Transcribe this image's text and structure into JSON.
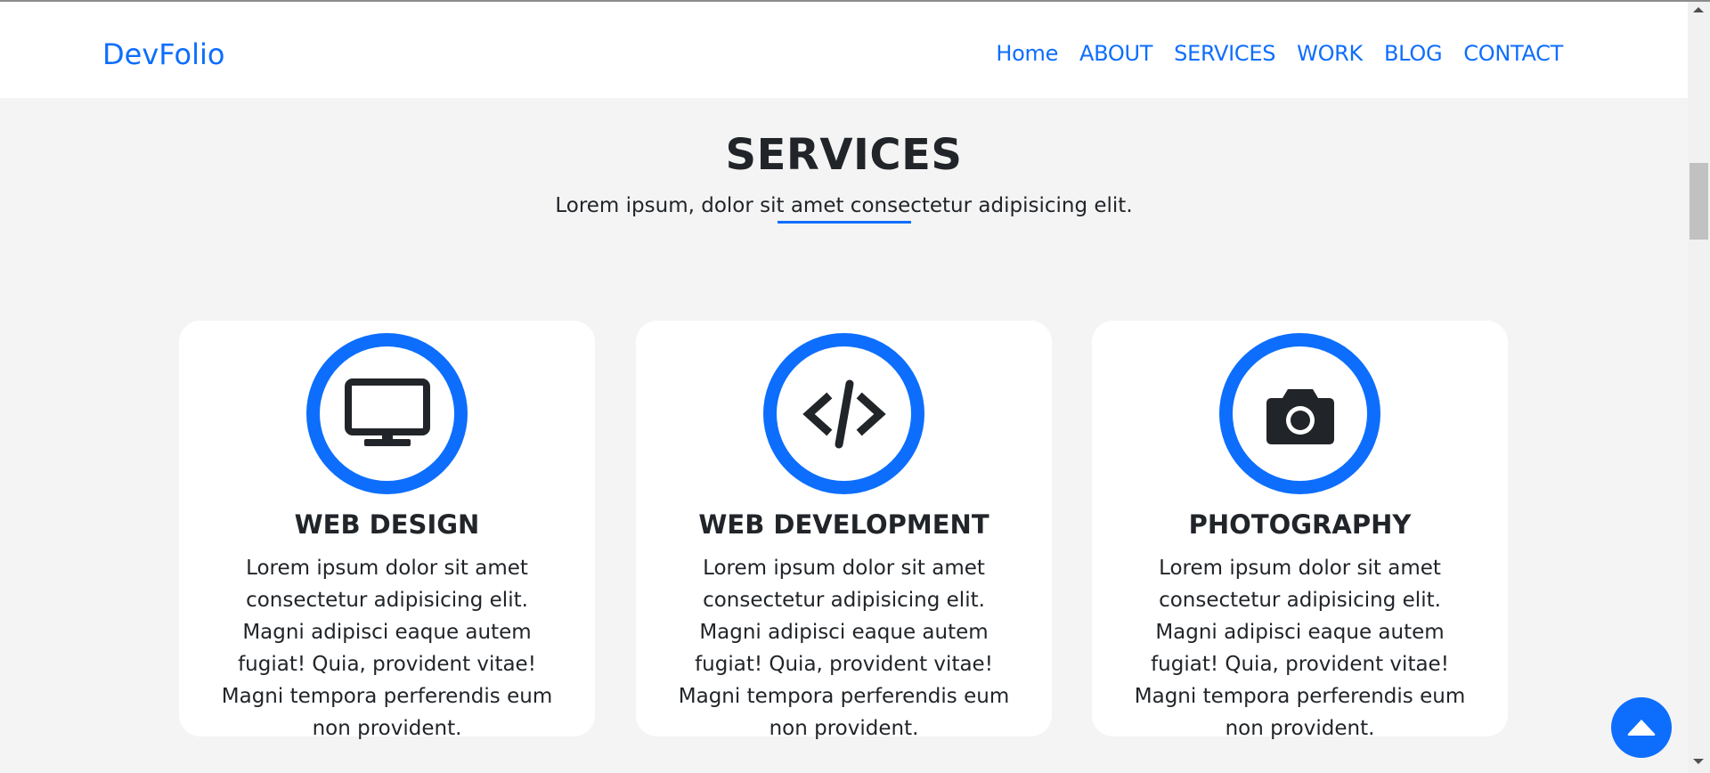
{
  "brand": "DevFolio",
  "nav": [
    "Home",
    "ABOUT",
    "SERVICES",
    "WORK",
    "BLOG",
    "CONTACT"
  ],
  "section": {
    "title": "SERVICES",
    "subtitle": "Lorem ipsum, dolor sit amet consectetur adipisicing elit."
  },
  "cards": [
    {
      "icon": "desktop-icon",
      "title": "WEB DESIGN",
      "text": "Lorem ipsum dolor sit amet consectetur adipisicing elit. Magni adipisci eaque autem fugiat! Quia, provident vitae! Magni tempora perferendis eum non provident."
    },
    {
      "icon": "code-icon",
      "title": "WEB DEVELOPMENT",
      "text": "Lorem ipsum dolor sit amet consectetur adipisicing elit. Magni adipisci eaque autem fugiat! Quia, provident vitae! Magni tempora perferendis eum non provident."
    },
    {
      "icon": "camera-icon",
      "title": "PHOTOGRAPHY",
      "text": "Lorem ipsum dolor sit amet consectetur adipisicing elit. Magni adipisci eaque autem fugiat! Quia, provident vitae! Magni tempora perferendis eum non provident."
    }
  ],
  "colors": {
    "accent": "#0d6efd",
    "background": "#f4f4f4",
    "text": "#212529"
  }
}
